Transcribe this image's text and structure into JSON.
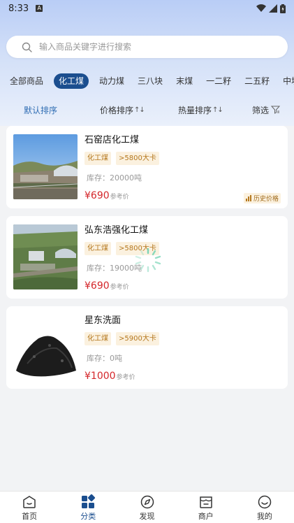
{
  "status_bar": {
    "time": "8:33",
    "notif_icon": "A"
  },
  "search": {
    "placeholder": "输入商品关键字进行搜索"
  },
  "category_tabs": [
    {
      "label": "全部商品",
      "active": false
    },
    {
      "label": "化工煤",
      "active": true
    },
    {
      "label": "动力煤",
      "active": false
    },
    {
      "label": "三八块",
      "active": false
    },
    {
      "label": "末煤",
      "active": false
    },
    {
      "label": "一二籽",
      "active": false
    },
    {
      "label": "二五籽",
      "active": false
    },
    {
      "label": "中块",
      "active": false
    }
  ],
  "sort_bar": {
    "default_label": "默认排序",
    "price_label": "价格排序",
    "calorific_label": "热量排序",
    "filter_label": "筛选",
    "sort_arrows": "↑↓"
  },
  "products": [
    {
      "title": "石窑店化工煤",
      "tags": [
        "化工煤",
        ">5800大卡"
      ],
      "stock": "库存：20000吨",
      "price": "¥690",
      "price_ref": "参考价",
      "history_label": "历史价格",
      "image": "industrial-plant-photo"
    },
    {
      "title": "弘东浩强化工煤",
      "tags": [
        "化工煤",
        ">5800大卡"
      ],
      "stock": "库存：19000吨",
      "price": "¥690",
      "price_ref": "参考价",
      "image": "aerial-plant-photo"
    },
    {
      "title": "星东洗面",
      "tags": [
        "化工煤",
        ">5900大卡"
      ],
      "stock": "库存：0吨",
      "price": "¥1000",
      "price_ref": "参考价",
      "image": "coal-pile-photo"
    }
  ],
  "bottom_nav": [
    {
      "label": "首页",
      "icon": "home-icon",
      "active": false
    },
    {
      "label": "分类",
      "icon": "category-icon",
      "active": true
    },
    {
      "label": "发现",
      "icon": "compass-icon",
      "active": false
    },
    {
      "label": "商户",
      "icon": "shop-icon",
      "active": false
    },
    {
      "label": "我的",
      "icon": "smile-icon",
      "active": false
    }
  ],
  "colors": {
    "accent": "#1b4e8f",
    "sort_active": "#2f6db3",
    "price": "#d4262a",
    "tag_bg": "#fbf1df",
    "tag_text": "#b5781e",
    "spinner": "#7dd6b8"
  }
}
